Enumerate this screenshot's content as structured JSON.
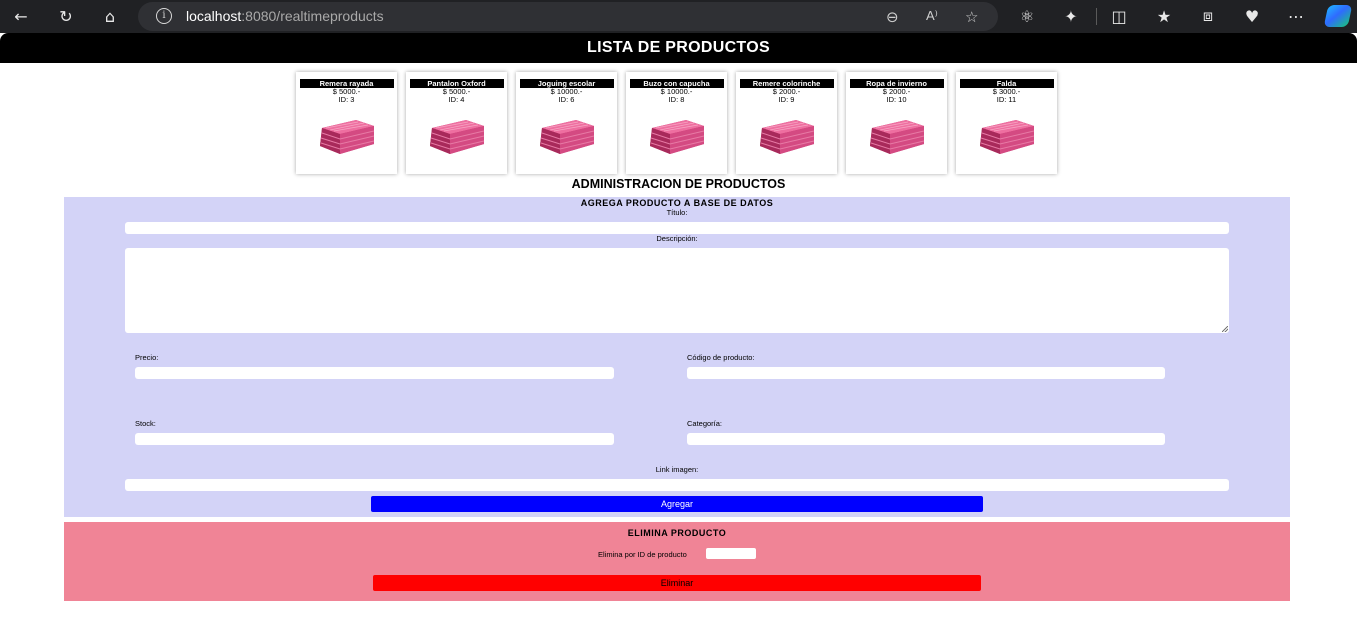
{
  "browser": {
    "url_host": "localhost",
    "url_rest": ":8080/realtimeproducts",
    "toolbar_icons": [
      "back-arrow-icon",
      "refresh-icon",
      "home-icon",
      "info-icon",
      "zoom-out-icon",
      "read-aloud-icon",
      "favorite-star-icon",
      "react-devtools-icon",
      "extensions-icon",
      "split-screen-icon",
      "favorites-icon",
      "collections-icon",
      "browser-essentials-icon",
      "more-icon",
      "copilot-icon"
    ]
  },
  "header": {
    "title": "LISTA DE PRODUCTOS"
  },
  "products": [
    {
      "name": "Remera rayada",
      "price": "$ 5000.-",
      "id": "ID: 3"
    },
    {
      "name": "Pantalon Oxford",
      "price": "$ 5000.-",
      "id": "ID: 4"
    },
    {
      "name": "Joguing escolar",
      "price": "$ 10000.-",
      "id": "ID: 6"
    },
    {
      "name": "Buzo con capucha",
      "price": "$ 10000.-",
      "id": "ID: 8"
    },
    {
      "name": "Remere colorinche",
      "price": "$ 2000.-",
      "id": "ID: 9"
    },
    {
      "name": "Ropa de invierno",
      "price": "$ 2000.-",
      "id": "ID: 10"
    },
    {
      "name": "Falda",
      "price": "$ 3000.-",
      "id": "ID: 11"
    }
  ],
  "admin": {
    "title": "ADMINISTRACION DE PRODUCTOS",
    "add": {
      "title": "AGREGA PRODUCTO A BASE DE DATOS",
      "titulo_label": "Título:",
      "descripcion_label": "Descripción:",
      "precio_label": "Precio:",
      "codigo_label": "Código de producto:",
      "stock_label": "Stock:",
      "categoria_label": "Categoría:",
      "imagen_label": "Link imagen:",
      "button": "Agregar"
    },
    "delete": {
      "title": "ELIMINA PRODUCTO",
      "label": "Elimina por ID de producto",
      "button": "Eliminar"
    }
  },
  "colors": {
    "add_bg": "#d3d3f7",
    "delete_bg": "#f08496",
    "add_button": "#0000ff",
    "delete_button": "#ff0000",
    "product_image": "#e0457f"
  }
}
